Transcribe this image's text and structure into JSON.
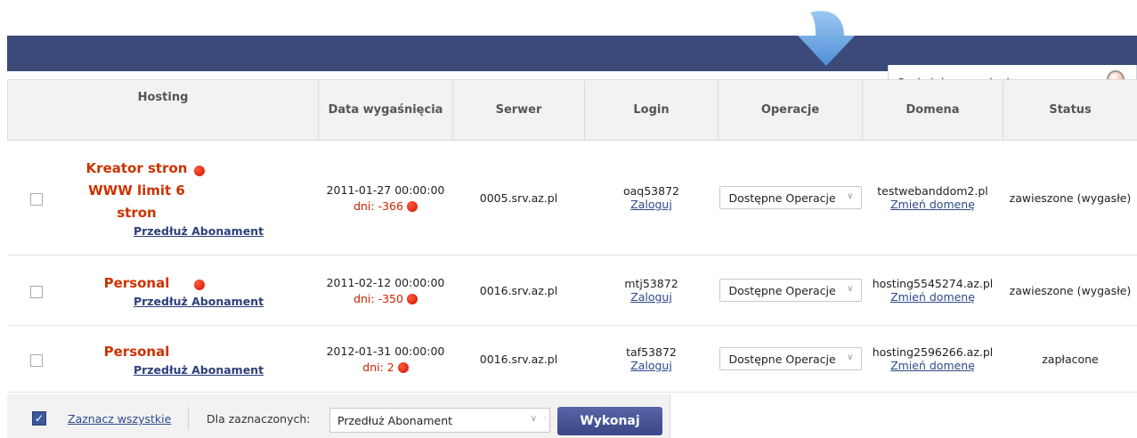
{
  "search": {
    "placeholder": "Szukaj domeny, loginu..."
  },
  "table": {
    "headers": [
      "Hosting",
      "Data wygaśnięcia",
      "Serwer",
      "Login",
      "Operacje",
      "Domena",
      "Status"
    ],
    "rows": [
      {
        "name_line1": "Kreator stron",
        "name_line2": "WWW limit 6",
        "name_line3": "stron",
        "renew": "Przedłuż Abonament",
        "date": "2011-01-27 00:00:00",
        "days": "dni: -366",
        "server": "0005.srv.az.pl",
        "login": "oaq53872",
        "login_link": "Zaloguj",
        "operations": "Dostępne Operacje",
        "domain": "testwebanddom2.pl",
        "domain_link": "Zmień domenę",
        "status": "zawieszone (wygasłe)"
      },
      {
        "name_line1": "Personal",
        "renew": "Przedłuż Abonament",
        "date": "2011-02-12 00:00:00",
        "days": "dni: -350",
        "server": "0016.srv.az.pl",
        "login": "mtj53872",
        "login_link": "Zaloguj",
        "operations": "Dostępne Operacje",
        "domain": "hosting5545274.az.pl",
        "domain_link": "Zmień domenę",
        "status": "zawieszone (wygasłe)"
      },
      {
        "name_line1": "Personal",
        "renew": "Przedłuż Abonament",
        "date": "2012-01-31 00:00:00",
        "days": "dni: 2",
        "server": "0016.srv.az.pl",
        "login": "taf53872",
        "login_link": "Zaloguj",
        "operations": "Dostępne Operacje",
        "domain": "hosting2596266.az.pl",
        "domain_link": "Zmień domenę",
        "status": "zapłacone"
      }
    ]
  },
  "footer": {
    "select_all": "Zaznacz wszystkie",
    "for_selected": "Dla zaznaczonych:",
    "action_value": "Przedłuż Abonament",
    "execute": "Wykonaj"
  },
  "colors": {
    "topbar": "#3c4a7a",
    "accent_red": "#cc3300",
    "link": "#2d4a8a",
    "button": "#3a4786"
  }
}
